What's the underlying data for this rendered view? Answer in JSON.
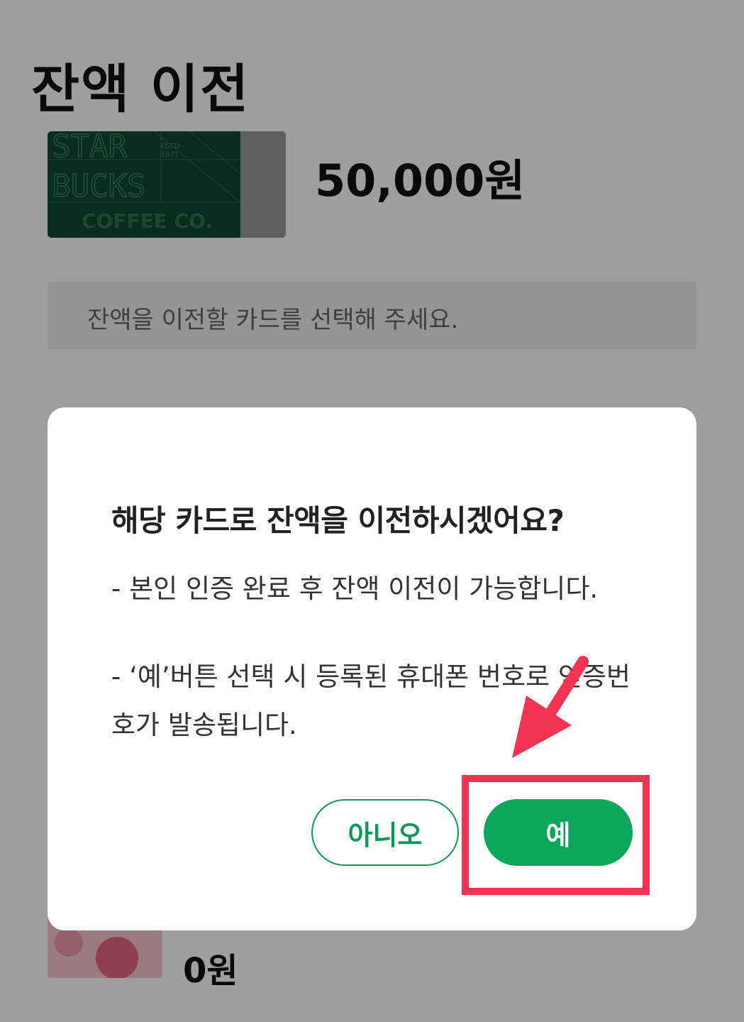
{
  "page": {
    "title": "잔액 이전",
    "source_card": {
      "amount": "50,000원",
      "logo_alt": "STARBUCKS COFFEE CO. ESTD 1971"
    },
    "select_hint": "잔액을 이전할 카드를 선택해 주세요.",
    "target_card": {
      "amount": "0원"
    }
  },
  "dialog": {
    "title": "해당 카드로 잔액을 이전하시겠어요?",
    "line1": "- 본인 인증 완료 후 잔액 이전이 가능합니다.",
    "line2": "- ‘예’버튼 선택 시 등록된 휴대폰 번호로 인증번호가 발송됩니다.",
    "no_label": "아니오",
    "yes_label": "예"
  },
  "annotation": {
    "color": "#f23452"
  },
  "colors": {
    "accent": "#0ba85c",
    "overlay": "rgba(0,0,0,0.38)"
  }
}
